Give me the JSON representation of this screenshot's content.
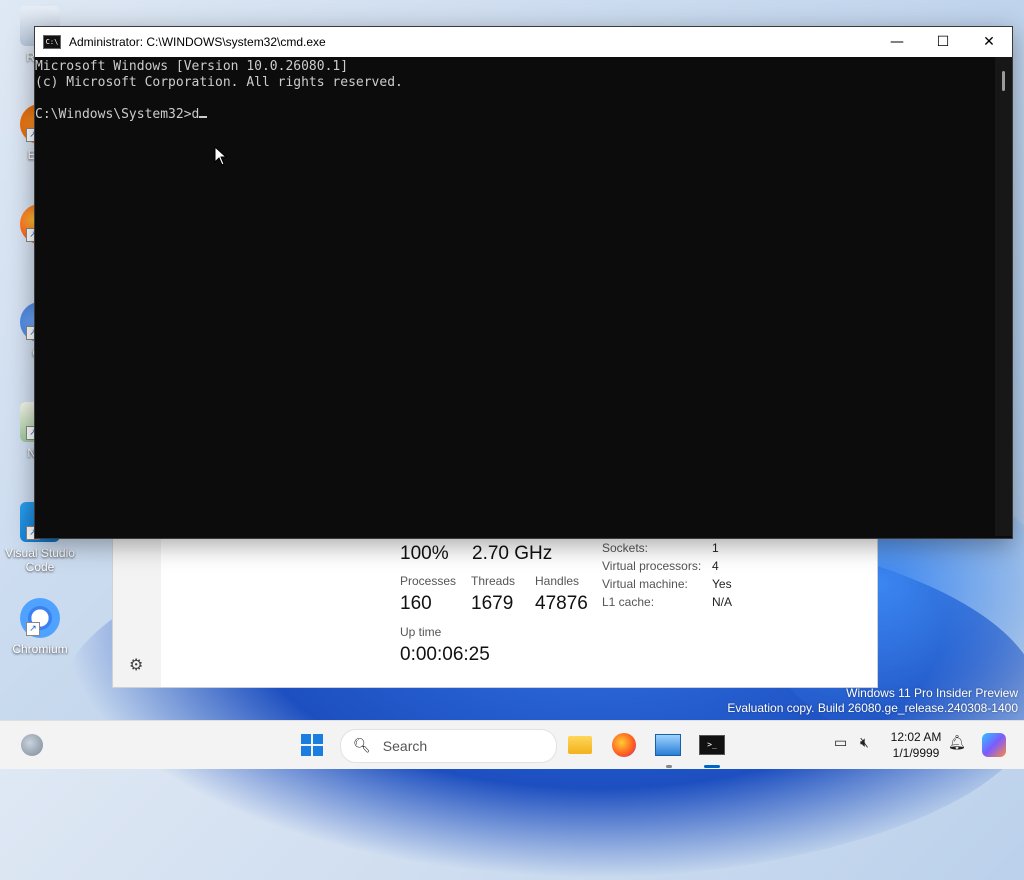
{
  "desktop": {
    "icons": [
      {
        "label": "Recy",
        "icon": "recycle-bin-icon"
      },
      {
        "label": "Ever",
        "icon": "everything-icon"
      },
      {
        "label": "Fi",
        "icon": "firefox-icon"
      },
      {
        "label": "Git",
        "icon": "git-icon"
      },
      {
        "label": "Note",
        "icon": "notepad-icon"
      },
      {
        "label": "Visual Studio Code",
        "icon": "vscode-icon"
      },
      {
        "label": "Chromium",
        "icon": "chromium-icon"
      }
    ],
    "watermark": {
      "line1": "Windows 11 Pro Insider Preview",
      "line2": "Evaluation copy. Build 26080.ge_release.240308-1400"
    }
  },
  "cmd_window": {
    "title": "Administrator: C:\\WINDOWS\\system32\\cmd.exe",
    "lines": [
      "Microsoft Windows [Version 10.0.26080.1]",
      "(c) Microsoft Corporation. All rights reserved.",
      "",
      "C:\\Windows\\System32>d"
    ],
    "controls": {
      "minimize": "—",
      "maximize": "☐",
      "close": "✕"
    }
  },
  "task_manager": {
    "utilization": "100%",
    "speed": "2.70 GHz",
    "processes_label": "Processes",
    "processes_value": "160",
    "threads_label": "Threads",
    "threads_value": "1679",
    "handles_label": "Handles",
    "handles_value": "47876",
    "uptime_label": "Up time",
    "uptime_value": "0:00:06:25",
    "details": [
      {
        "key": "Sockets:",
        "value": "1"
      },
      {
        "key": "Virtual processors:",
        "value": "4"
      },
      {
        "key": "Virtual machine:",
        "value": "Yes"
      },
      {
        "key": "L1 cache:",
        "value": "N/A"
      }
    ]
  },
  "taskbar": {
    "search_placeholder": "Search",
    "time": "12:02 AM",
    "date": "1/1/9999",
    "apps": [
      "start-icon",
      "file-explorer-icon",
      "firefox-icon",
      "task-manager-icon",
      "cmd-icon"
    ]
  },
  "colors": {
    "console_bg": "#0c0c0c",
    "console_fg": "#cccccc",
    "accent": "#0067c0"
  }
}
